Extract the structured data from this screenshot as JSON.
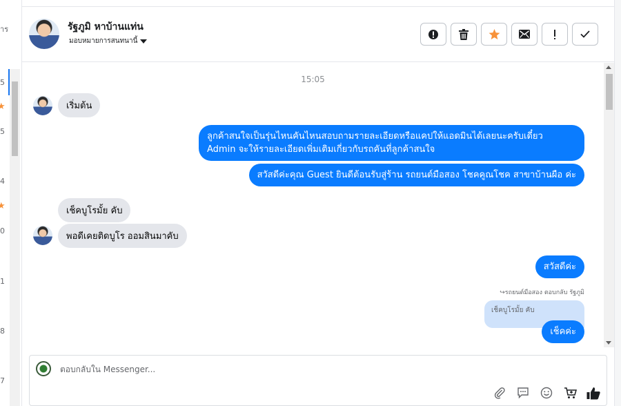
{
  "left_list": {
    "fragments": [
      "าร",
      "5",
      "5",
      "4",
      "0",
      "1",
      "8",
      "7"
    ]
  },
  "header": {
    "contact_name": "รัฐภูมิ หาบ้านแท่น",
    "assign_label": "มอบหมายการสนทนานี้"
  },
  "toolbar": {
    "icons": [
      "alert-circle-icon",
      "trash-icon",
      "star-icon",
      "envelope-icon",
      "exclamation-icon",
      "check-icon"
    ],
    "star_color": "#f7923a"
  },
  "messages": {
    "timestamp": "15:05",
    "items": [
      {
        "side": "in",
        "text": "เริ่มต้น"
      },
      {
        "side": "out",
        "line1": "ลูกค้าสนใจเป็นรุ่นไหนคันไหนสอบถามรายละเอียดหรือแคปให้แอดมินได้เลยนะครับเดี๋ยว",
        "line2": "Admin จะให้รายละเอียดเพิ่มเติมเกี่ยวกับรถคันที่ลูกค้าสนใจ"
      },
      {
        "side": "out",
        "text": "สวัสดีค่ะคุณ Guest ยินดีต้อนรับสู่ร้าน รถยนต์มือสอง โชคคูณโชค สาขาบ้านผือ ค่ะ"
      },
      {
        "side": "in",
        "text": "เช็คบูโรมั้ย คับ"
      },
      {
        "side": "in",
        "text": "พอดีเคยติดบูโร ออมสินมาคับ"
      },
      {
        "side": "out",
        "text": "สวัสดีค่ะ"
      },
      {
        "side": "out",
        "text": "เช็คค่ะ"
      }
    ],
    "reply_meta": "รถยนต์มือสอง ตอบกลับ รัฐภูมิ",
    "quoted_text": "เช็คบูโรมั้ย คับ"
  },
  "composer": {
    "placeholder": "ตอบกลับใน Messenger...",
    "icons": [
      "paperclip-icon",
      "chat-bubble-icon",
      "emoji-icon",
      "cart-icon",
      "thumbs-up-icon"
    ]
  },
  "colors": {
    "accent": "#0a7cff",
    "incoming_bubble": "#e4e6eb",
    "quoted_bubble": "#cfe2fb"
  }
}
